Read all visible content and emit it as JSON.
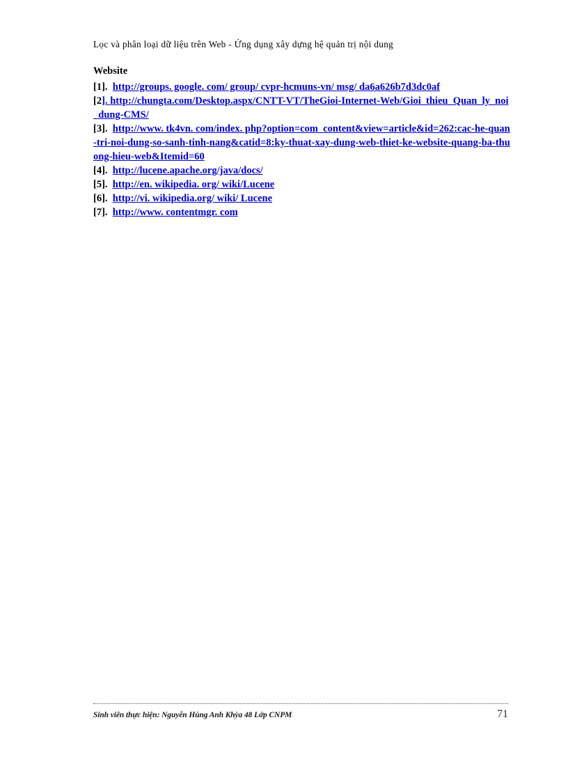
{
  "header": {
    "running_title": "Lọc và phân loại dữ liệu trên Web - Ứng dụng xây dựng hệ quản trị nội dung"
  },
  "section": {
    "title": "Website"
  },
  "references": [
    {
      "marker": "[1].",
      "marker_black": "[1].",
      "marker_link": "",
      "url": "http://groups. google. com/ group/ cvpr-hcmuns-vn/ msg/ da6a626b7d3dc0af"
    },
    {
      "marker": "[2].",
      "marker_black": "[2",
      "marker_link": "]. ",
      "url": "http://chungta.com/Desktop.aspx/CNTT-VT/TheGioi-Internet-Web/Gioi_thieu_Quan_ly_noi_dung-CMS/"
    },
    {
      "marker": "[3].",
      "marker_black": "[3].",
      "marker_link": "",
      "url": "http://www. tk4vn. com/index. php?option=com_content&view=article&id=262:cac-he-quan-tri-noi-dung-so-sanh-tinh-nang&catid=8:ky-thuat-xay-dung-web-thiet-ke-website-quang-ba-thuong-hieu-web&Itemid=60"
    },
    {
      "marker": "[4].",
      "marker_black": "[4].",
      "marker_link": "",
      "url": "http://lucene.apache.org/java/docs/"
    },
    {
      "marker": "[5].",
      "marker_black": "[5].",
      "marker_link": "",
      "url": "http://en. wikipedia. org/ wiki/Lucene"
    },
    {
      "marker": "[6].",
      "marker_black": "[6].",
      "marker_link": "",
      "url": "http://vi. wikipedia.org/ wiki/ Lucene"
    },
    {
      "marker": "[7].",
      "marker_black": "[7].",
      "marker_link": "",
      "url": "http://www. contentmgr. com"
    }
  ],
  "footer": {
    "credit": "Sinh viên thực hiện: Nguyễn Hùng Anh Khỳa 48 Lớp CNPM",
    "page_number": "71"
  },
  "colors": {
    "link": "#0000CC",
    "text": "#000000",
    "footer_rule": "#555555"
  }
}
